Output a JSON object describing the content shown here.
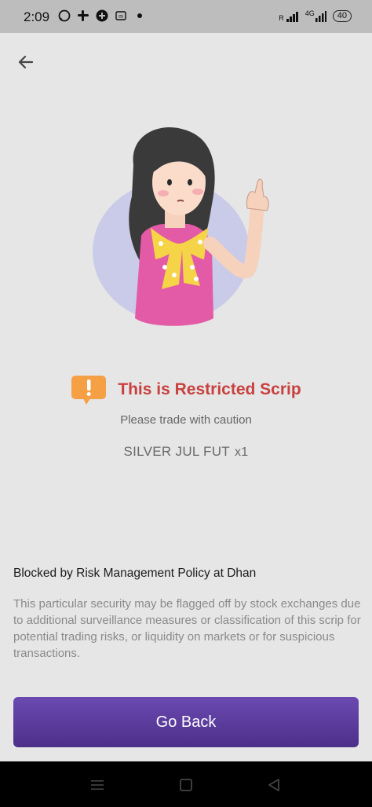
{
  "status_bar": {
    "time": "2:09",
    "signal_text": "R",
    "network_text": "4G",
    "battery": "40"
  },
  "icons": {
    "back": "arrow-left-icon",
    "warning": "warning-speech-icon",
    "nav_recent": "menu-icon",
    "nav_home": "square-icon",
    "nav_back": "triangle-back-icon"
  },
  "restriction": {
    "title": "This is Restricted Scrip",
    "subtitle": "Please trade with caution",
    "scrip_name": "SILVER JUL FUT",
    "scrip_qty": "x1"
  },
  "policy": {
    "title": "Blocked by Risk Management Policy at Dhan",
    "description": "This particular security may be flagged off by stock exchanges due to additional surveillance measures or classification of this scrip for potential trading risks, or liquidity on markets or for suspicious transactions."
  },
  "actions": {
    "go_back_label": "Go Back"
  },
  "colors": {
    "title_red": "#c9413f",
    "button_purple": "#5a3a9c",
    "warning_orange": "#f5a045"
  }
}
